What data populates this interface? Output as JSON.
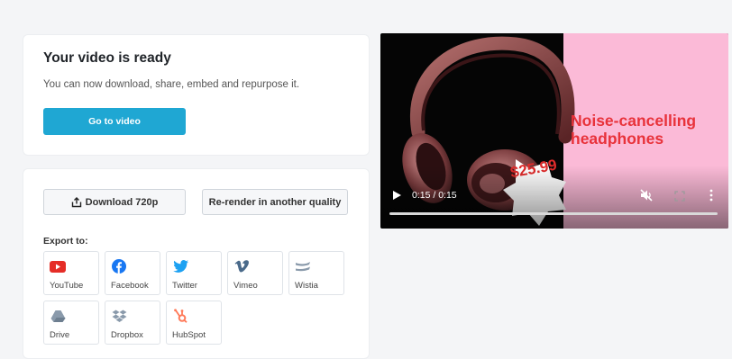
{
  "ready": {
    "title": "Your video is ready",
    "subtitle": "You can now download, share, embed and repurpose it.",
    "go_button": "Go to video"
  },
  "actions": {
    "download": "Download 720p",
    "rerender": "Re-render in another quality"
  },
  "export": {
    "label": "Export to:",
    "targets": [
      {
        "label": "YouTube",
        "icon": "youtube-icon",
        "color": "#e52d27"
      },
      {
        "label": "Facebook",
        "icon": "facebook-icon",
        "color": "#1877f2"
      },
      {
        "label": "Twitter",
        "icon": "twitter-icon",
        "color": "#1da1f2"
      },
      {
        "label": "Vimeo",
        "icon": "vimeo-icon",
        "color": "#4a6a8a"
      },
      {
        "label": "Wistia",
        "icon": "wistia-icon",
        "color": "#8a9aab"
      },
      {
        "label": "Drive",
        "icon": "drive-icon",
        "color": "#8a9aab"
      },
      {
        "label": "Dropbox",
        "icon": "dropbox-icon",
        "color": "#8a9aab"
      },
      {
        "label": "HubSpot",
        "icon": "hubspot-icon",
        "color": "#ff7a59"
      }
    ]
  },
  "video": {
    "headline": "Noise-cancelling headphones",
    "price": "$25.99",
    "time": "0:15 / 0:15",
    "progress": 1.0,
    "accent": "#e8323a",
    "panel_color": "#fbbad7"
  },
  "colors": {
    "primary": "#1fa7d3"
  }
}
